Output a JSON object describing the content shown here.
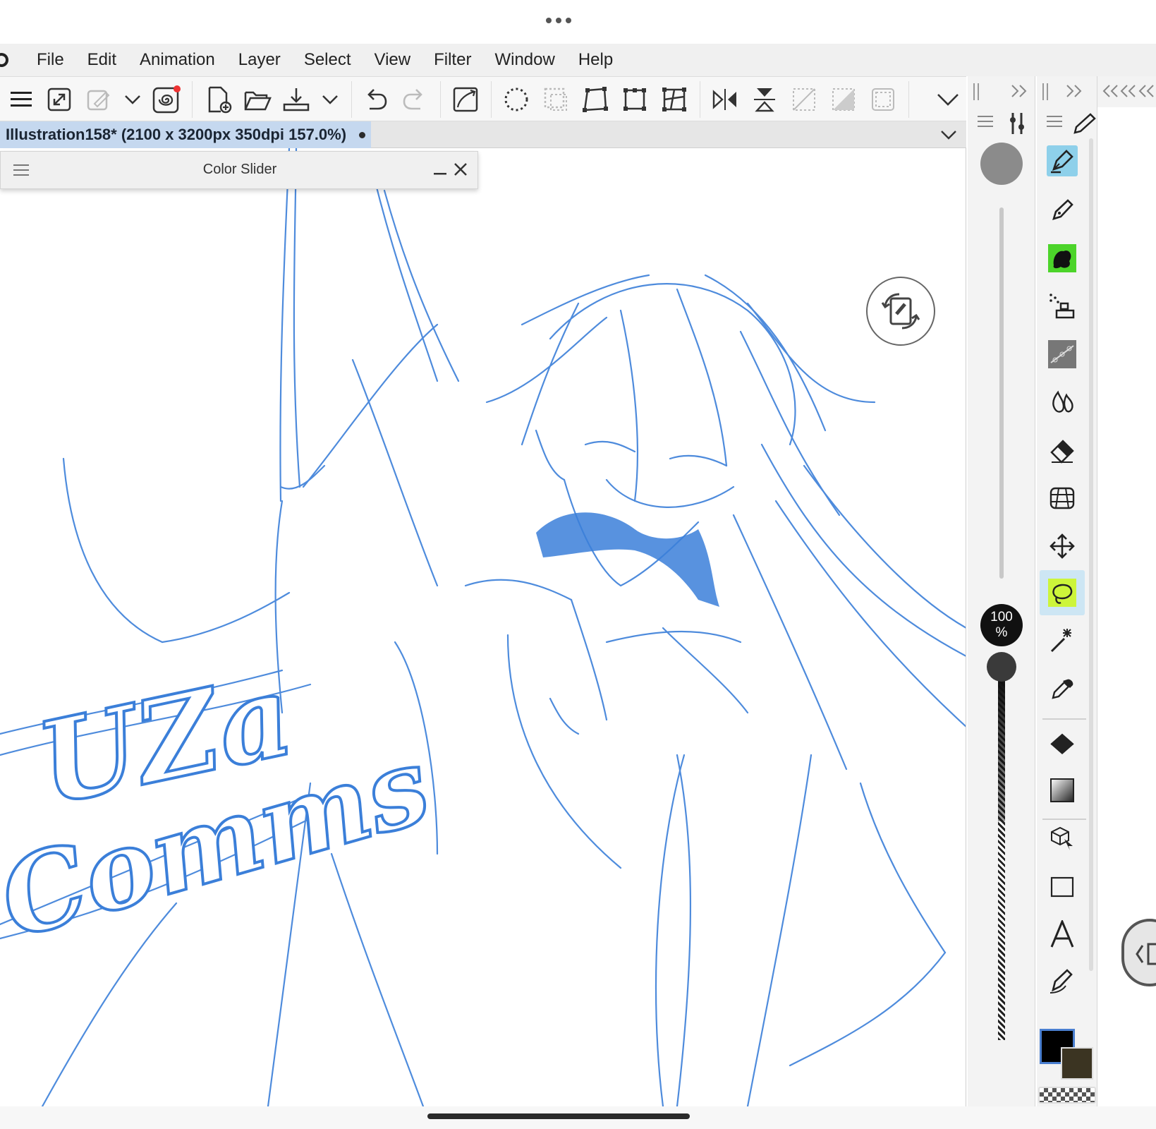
{
  "menu": {
    "items": [
      "File",
      "Edit",
      "Animation",
      "Layer",
      "Select",
      "View",
      "Filter",
      "Window",
      "Help"
    ]
  },
  "document": {
    "tab_title": "Illustration158* (2100 x 3200px 350dpi 157.0%)"
  },
  "color_slider_panel": {
    "title": "Color Slider"
  },
  "brush": {
    "opacity_value": "100",
    "opacity_unit": "%"
  },
  "canvas_art": {
    "watermark_line1": "UZa",
    "watermark_line2": "Comms",
    "stroke_color": "#3b7fd9"
  },
  "colors": {
    "main": "#000000",
    "sub": "#3b3422",
    "accent_active_tool": "#8ed0ea",
    "tab_bg": "#c5d8ef"
  },
  "toolbar_icons": [
    "menu-icon",
    "fit-screen-icon",
    "edit-icon",
    "chevron-down-icon",
    "spiral-icon",
    "new-file-icon",
    "open-folder-icon",
    "export-icon",
    "chevron-down-icon",
    "undo-icon",
    "redo-icon",
    "canvas-resize-icon",
    "select-all-icon",
    "deselect-icon",
    "transform-icon",
    "crop-icon",
    "mesh-transform-icon",
    "flip-horizontal-icon",
    "flip-vertical-icon",
    "show-selection-icon",
    "clear-icon",
    "invert-icon",
    "more-chevron-icon"
  ],
  "tool_icons": [
    "pen-tool",
    "pencil-tool",
    "brush-tool",
    "airbrush-tool",
    "decoration-tool",
    "blend-tool",
    "eraser-tool",
    "perspective-tool",
    "move-tool",
    "lasso-tool",
    "auto-select-tool",
    "eyedropper-tool",
    "fill-tool",
    "gradient-tool",
    "object-tool",
    "figure-tool",
    "text-tool",
    "vector-pen-tool"
  ]
}
